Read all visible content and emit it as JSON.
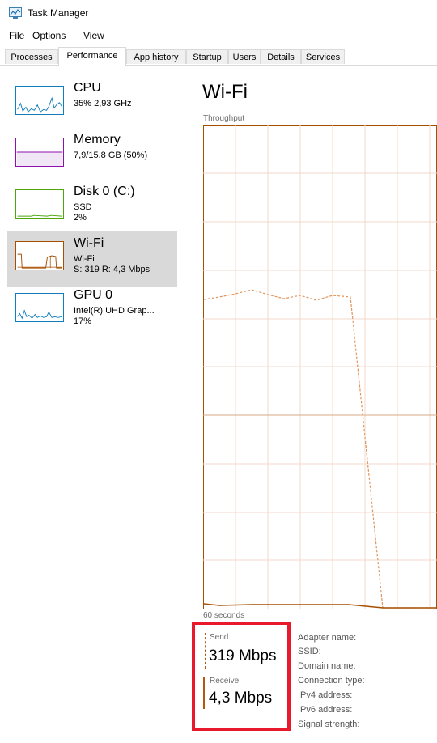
{
  "window": {
    "title": "Task Manager"
  },
  "menu": [
    "File",
    "Options",
    "View"
  ],
  "tabs": [
    {
      "label": "Processes",
      "active": false
    },
    {
      "label": "Performance",
      "active": true
    },
    {
      "label": "App history",
      "active": false
    },
    {
      "label": "Startup",
      "active": false
    },
    {
      "label": "Users",
      "active": false
    },
    {
      "label": "Details",
      "active": false
    },
    {
      "label": "Services",
      "active": false
    }
  ],
  "sidebar": {
    "items": [
      {
        "name": "CPU",
        "line1": "35% 2,93 GHz",
        "line2": "",
        "color": "#117dbb"
      },
      {
        "name": "Memory",
        "line1": "7,9/15,8 GB (50%)",
        "line2": "",
        "color": "#8b12ae"
      },
      {
        "name": "Disk 0 (C:)",
        "line1": "SSD",
        "line2": "2%",
        "color": "#4da60c"
      },
      {
        "name": "Wi-Fi",
        "line1": "Wi-Fi",
        "line2": "S: 319 R: 4,3 Mbps",
        "color": "#a74f01",
        "selected": true
      },
      {
        "name": "GPU 0",
        "line1": "Intel(R) UHD Grap...",
        "line2": "17%",
        "color": "#117dbb"
      }
    ]
  },
  "main": {
    "title": "Wi-Fi",
    "graph_label": "Throughput",
    "time_label": "60 seconds",
    "graph_color": "#a74f01"
  },
  "stats": {
    "send_label": "Send",
    "send_value": "319 Mbps",
    "receive_label": "Receive",
    "receive_value": "4,3 Mbps"
  },
  "properties": [
    "Adapter name:",
    "SSID:",
    "Domain name:",
    "Connection type:",
    "IPv4 address:",
    "IPv6 address:",
    "Signal strength:"
  ]
}
